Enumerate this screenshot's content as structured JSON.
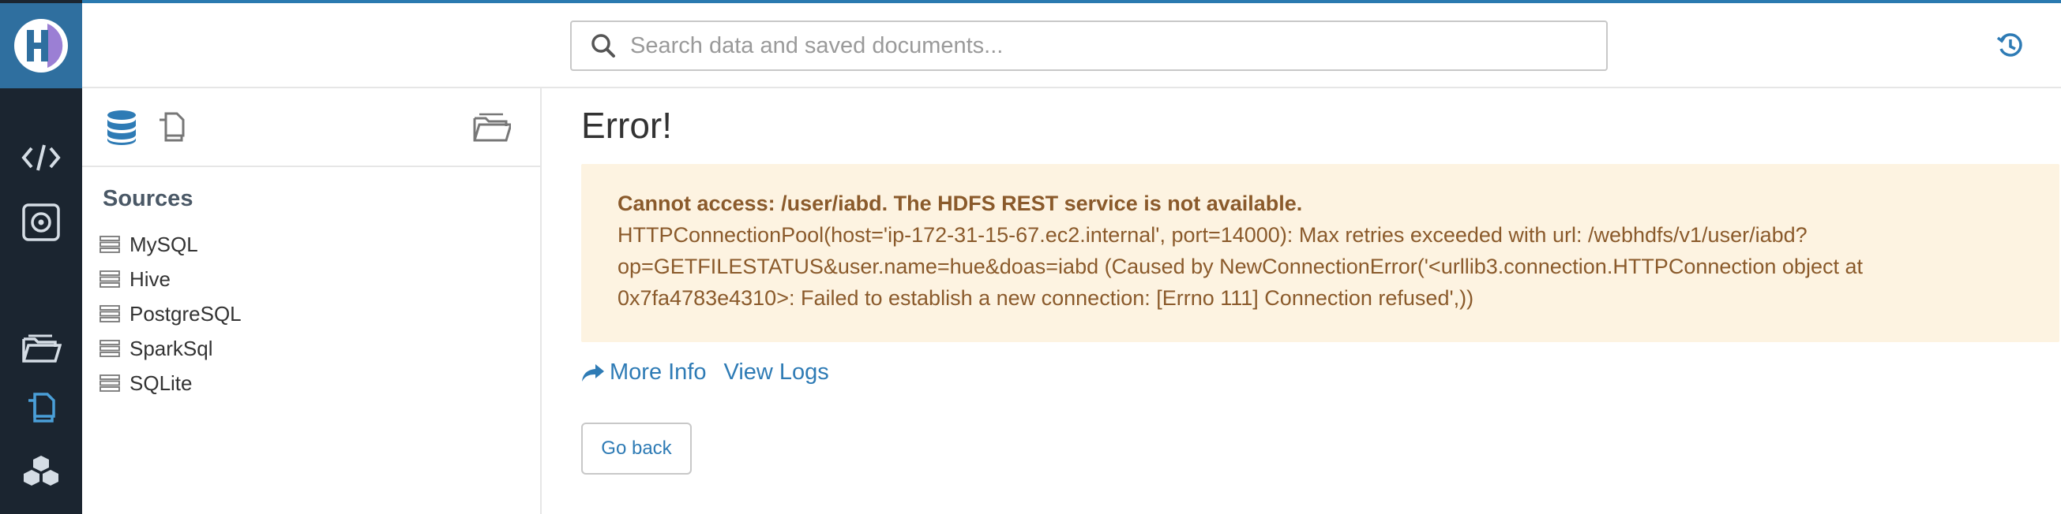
{
  "colors": {
    "accent": "#2e7bb5",
    "rail": "#1b2530",
    "alert_bg": "#fdf3e1",
    "alert_text": "#8a5a2b"
  },
  "header": {
    "search_placeholder": "Search data and saved documents...",
    "history_icon": "history-icon"
  },
  "rail": {
    "items": [
      {
        "icon": "code-editor-icon"
      },
      {
        "icon": "dashboard-icon"
      },
      {
        "icon": "folder-open-icon"
      },
      {
        "icon": "documents-icon"
      },
      {
        "icon": "cubes-icon"
      }
    ]
  },
  "left_panel": {
    "tabs": [
      {
        "icon": "database-icon"
      },
      {
        "icon": "documents-icon"
      },
      {
        "icon": "folder-open-icon"
      }
    ],
    "sources_title": "Sources",
    "sources": [
      {
        "label": "MySQL"
      },
      {
        "label": "Hive"
      },
      {
        "label": "PostgreSQL"
      },
      {
        "label": "SparkSql"
      },
      {
        "label": "SQLite"
      }
    ]
  },
  "main": {
    "title": "Error!",
    "alert_strong": "Cannot access: /user/iabd. The HDFS REST service is not available.",
    "alert_detail": "HTTPConnectionPool(host='ip-172-31-15-67.ec2.internal', port=14000): Max retries exceeded with url: /webhdfs/v1/user/iabd?op=GETFILESTATUS&user.name=hue&doas=iabd (Caused by NewConnectionError('<urllib3.connection.HTTPConnection object at 0x7fa4783e4310>: Failed to establish a new connection: [Errno 111] Connection refused',))",
    "more_info": "More Info",
    "view_logs": "View Logs",
    "go_back": "Go back"
  }
}
